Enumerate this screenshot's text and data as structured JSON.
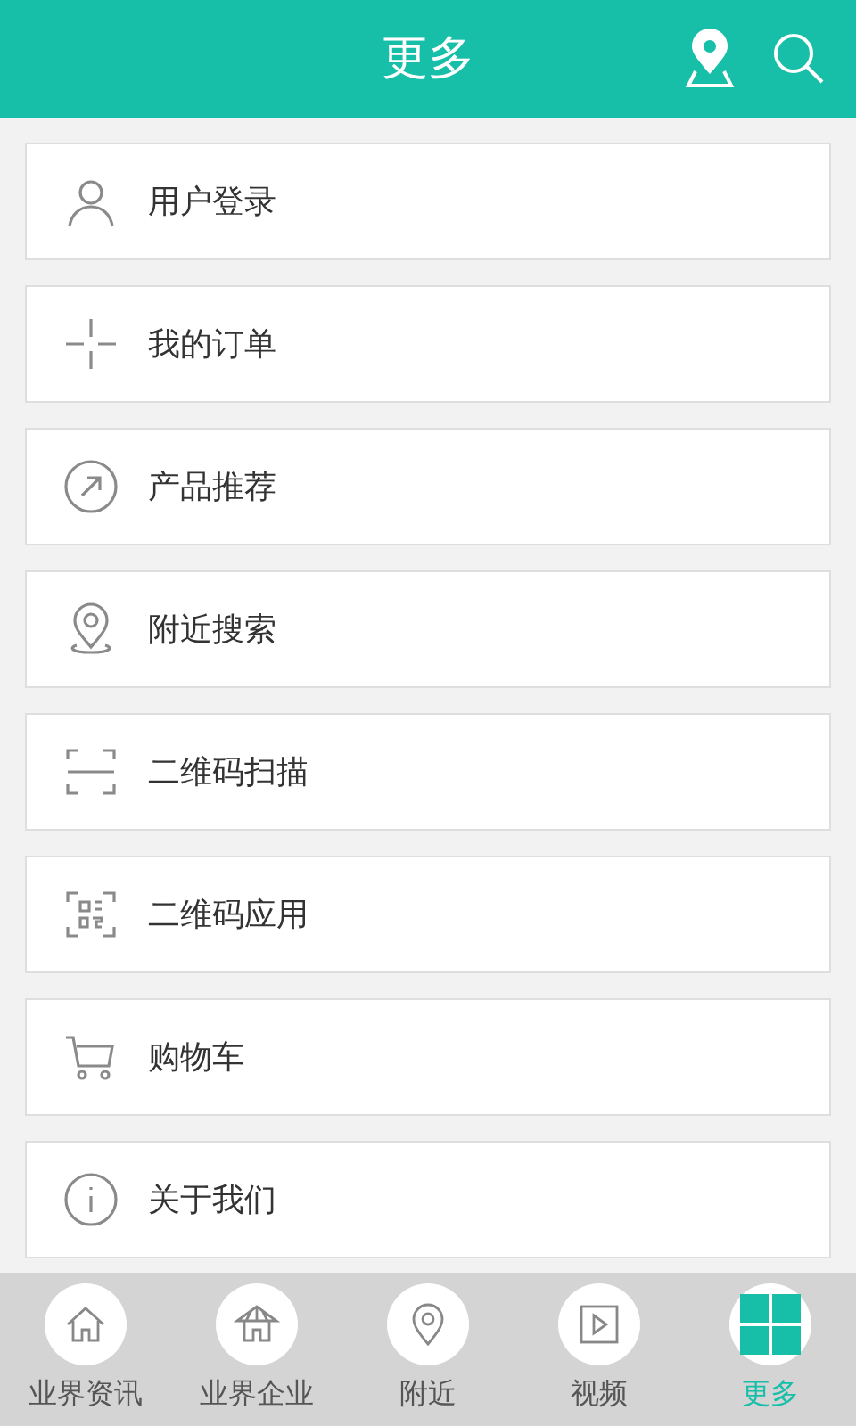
{
  "header": {
    "title": "更多"
  },
  "menu": [
    {
      "label": "用户登录"
    },
    {
      "label": "我的订单"
    },
    {
      "label": "产品推荐"
    },
    {
      "label": "附近搜索"
    },
    {
      "label": "二维码扫描"
    },
    {
      "label": "二维码应用"
    },
    {
      "label": "购物车"
    },
    {
      "label": "关于我们"
    }
  ],
  "tabs": [
    {
      "label": "业界资讯",
      "selected": false
    },
    {
      "label": "业界企业",
      "selected": false
    },
    {
      "label": "附近",
      "selected": false
    },
    {
      "label": "视频",
      "selected": false
    },
    {
      "label": "更多",
      "selected": true
    }
  ]
}
